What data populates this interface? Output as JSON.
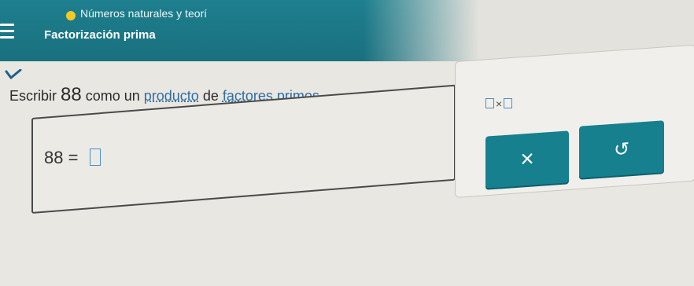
{
  "header": {
    "topic": "Números naturales y teorí",
    "subtopic": "Factorización prima",
    "accent_color": "#1e7f8e",
    "topic_dot_color": "#f3c928"
  },
  "icons": {
    "menu": "menu-icon",
    "collapse": "chevron-down-icon",
    "clear": "close-icon",
    "undo": "undo-icon"
  },
  "instruction": {
    "prefix": "Escribir ",
    "number": "88",
    "mid": " como un ",
    "link1": "producto",
    "of": " de ",
    "link2": "factores primos",
    "end": "."
  },
  "answer": {
    "lhs": "88",
    "equals": "="
  },
  "tools": {
    "times_symbol": "×",
    "clear_symbol": "×",
    "undo_symbol": "↺"
  }
}
